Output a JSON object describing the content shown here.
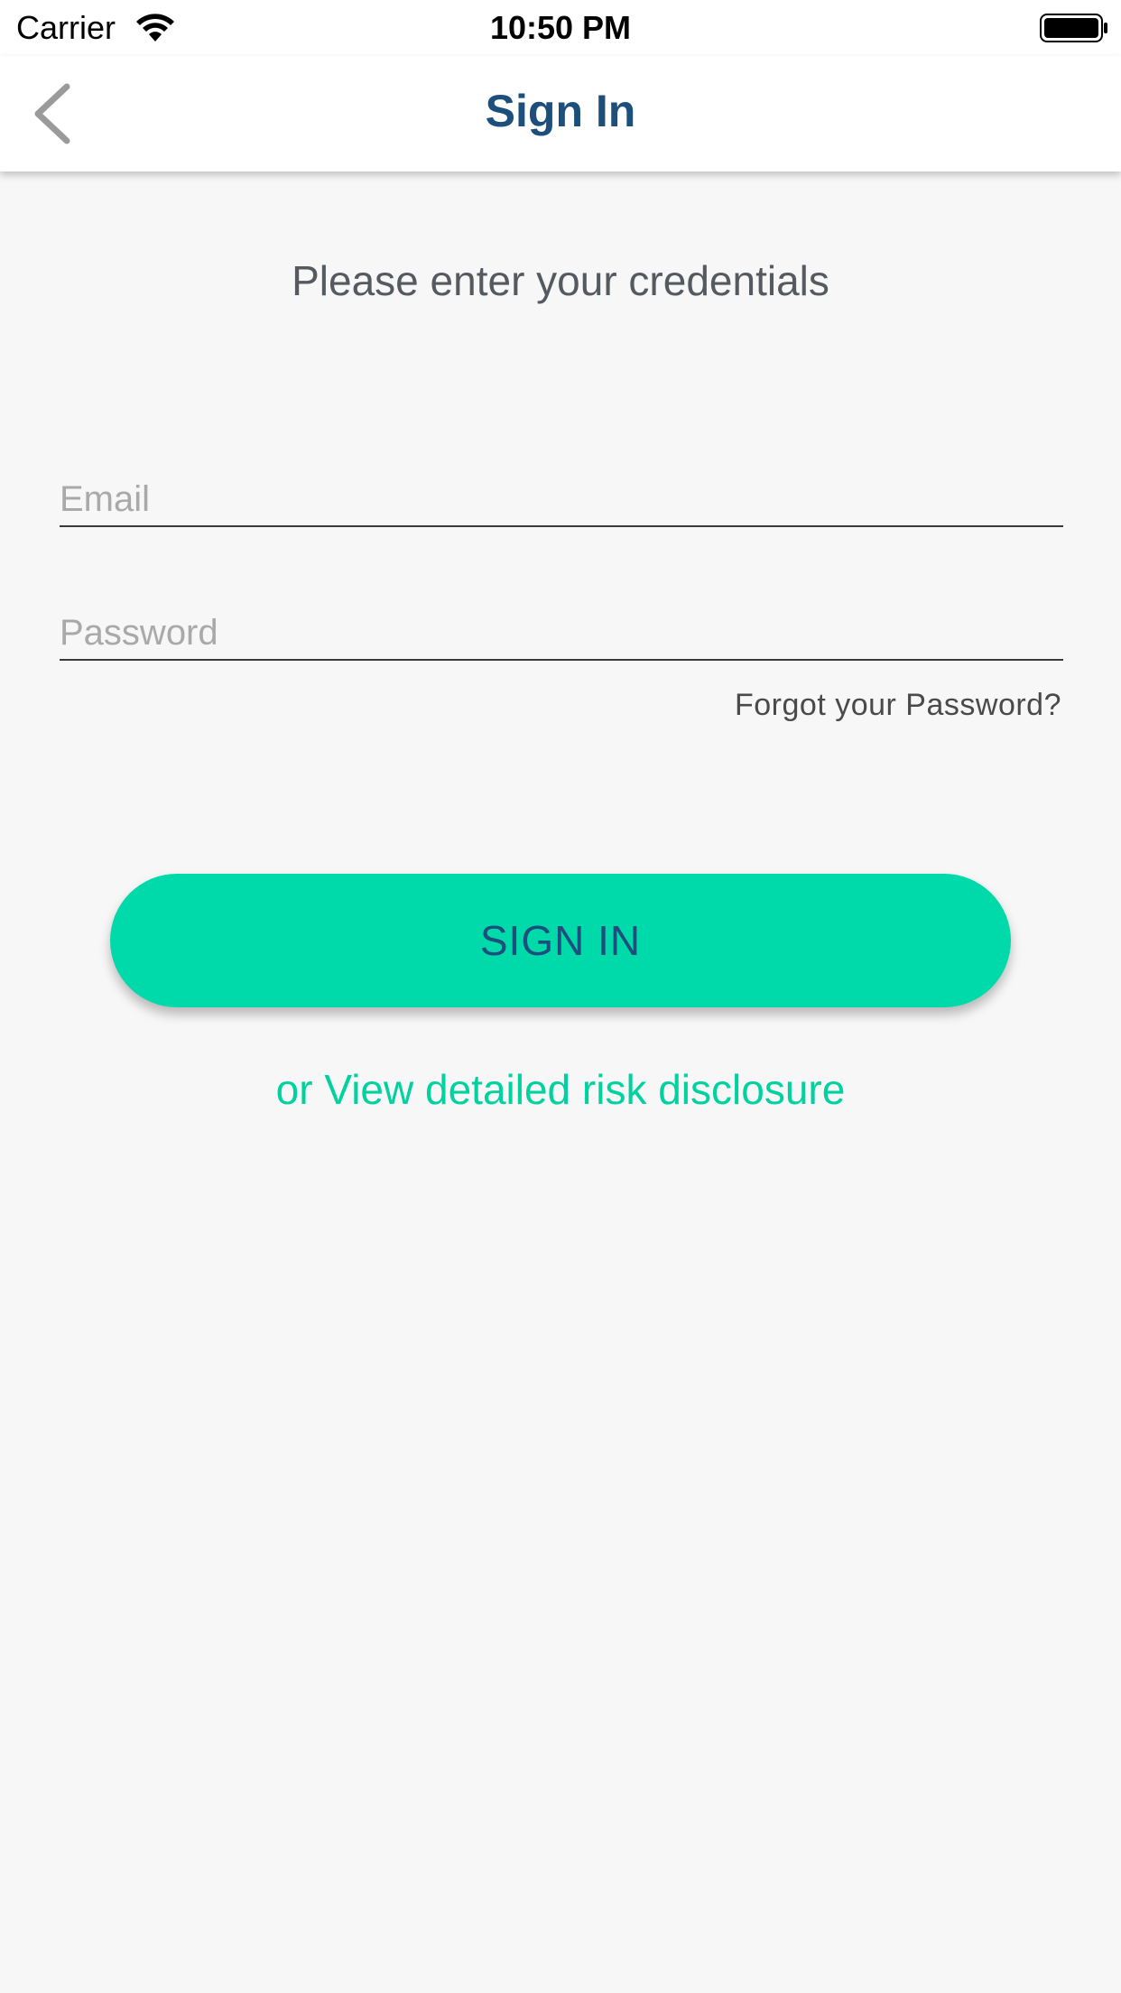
{
  "status_bar": {
    "carrier": "Carrier",
    "time": "10:50 PM",
    "icons": [
      "wifi-icon",
      "battery-icon"
    ]
  },
  "nav": {
    "back_icon": "chevron-left-icon",
    "title": "Sign In"
  },
  "form": {
    "subtitle": "Please enter your credentials",
    "email": {
      "placeholder": "Email",
      "value": ""
    },
    "password": {
      "placeholder": "Password",
      "value": ""
    },
    "forgot_label": "Forgot your Password?",
    "sign_in_label": "SIGN IN",
    "risk_link_label": "or View detailed risk disclosure"
  },
  "colors": {
    "accent": "#00d9aa",
    "title_blue": "#1d4f7c",
    "link_green": "#00d29f",
    "background": "#f7f7f7"
  }
}
